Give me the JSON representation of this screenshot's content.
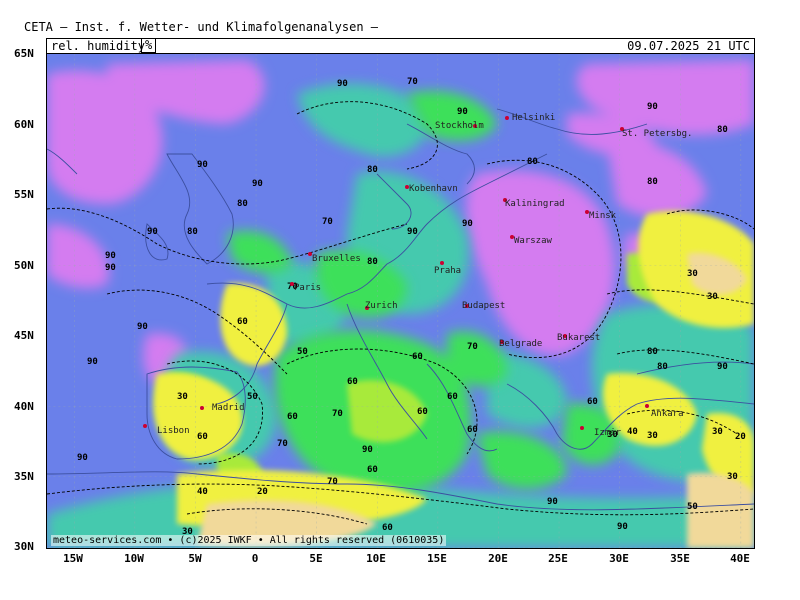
{
  "header": {
    "title": "CETA — Inst. f. Wetter- und Klimafolgenanalysen —",
    "parameter": "rel. humidity",
    "unit": "%",
    "valid_time": "09.07.2025 21 UTC"
  },
  "footer": {
    "copyright": "meteo-services.com • (c)2025 IWKF • All rights reserved (0610035)"
  },
  "axes": {
    "lat_ticks": [
      "65N",
      "60N",
      "55N",
      "50N",
      "45N",
      "40N",
      "35N",
      "30N"
    ],
    "lon_ticks": [
      "15W",
      "10W",
      "5W",
      "0",
      "5E",
      "10E",
      "15E",
      "20E",
      "25E",
      "30E",
      "35E",
      "40E"
    ]
  },
  "cities": [
    {
      "name": "Helsinki"
    },
    {
      "name": "Stockholm"
    },
    {
      "name": "St. Petersbg."
    },
    {
      "name": "Kobenhavn"
    },
    {
      "name": "Kaliningrad"
    },
    {
      "name": "Minsk"
    },
    {
      "name": "Warszaw"
    },
    {
      "name": "Bruxelles"
    },
    {
      "name": "Praha"
    },
    {
      "name": "Paris"
    },
    {
      "name": "Zurich"
    },
    {
      "name": "Budapest"
    },
    {
      "name": "Belgrade"
    },
    {
      "name": "Bukarest"
    },
    {
      "name": "Madrid"
    },
    {
      "name": "Lisbon"
    },
    {
      "name": "Ankara"
    },
    {
      "name": "Izmir"
    }
  ],
  "contour_values": [
    "90",
    "80",
    "70",
    "60",
    "50",
    "40",
    "30",
    "20"
  ],
  "colors": {
    "rh_90_100": "#d47cf0",
    "rh_80_90": "#6a80ea",
    "rh_70_80": "#44c9ae",
    "rh_60_70": "#3ee05a",
    "rh_50_60": "#a8ea3a",
    "rh_40_50": "#f0f040",
    "rh_30_40": "#f7e94a",
    "rh_20_30": "#f1d99a",
    "land_border": "#3c4fa0"
  }
}
